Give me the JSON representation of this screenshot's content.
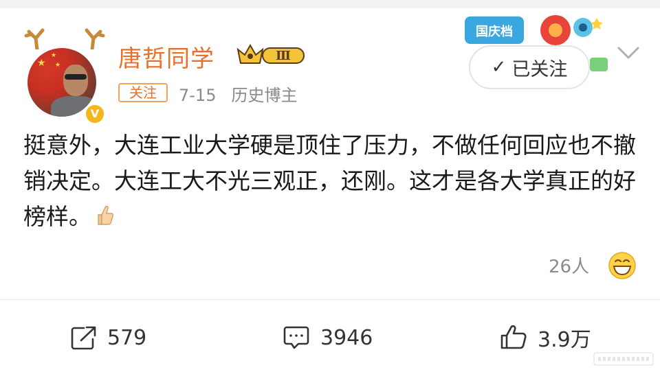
{
  "user": {
    "name": "唐哲同学",
    "rank_badge": "Ⅲ",
    "follow_tag": "关注",
    "date": "7-15",
    "source": "历史博主",
    "verified_mark": "V"
  },
  "header": {
    "follow_button": "已关注",
    "promo_text": "国庆档"
  },
  "post": {
    "text": "挺意外，大连工业大学硬是顶住了压力，不做任何回应也不撤销决定。大连工大不光三观正，还刚。这才是各大学真正的好榜样。"
  },
  "reactions": {
    "count": "26人"
  },
  "actions": {
    "repost": "579",
    "comment": "3946",
    "like": "3.9万"
  },
  "colors": {
    "accent": "#e8702c",
    "muted": "#8a8a8a",
    "text": "#1a1a1a"
  }
}
